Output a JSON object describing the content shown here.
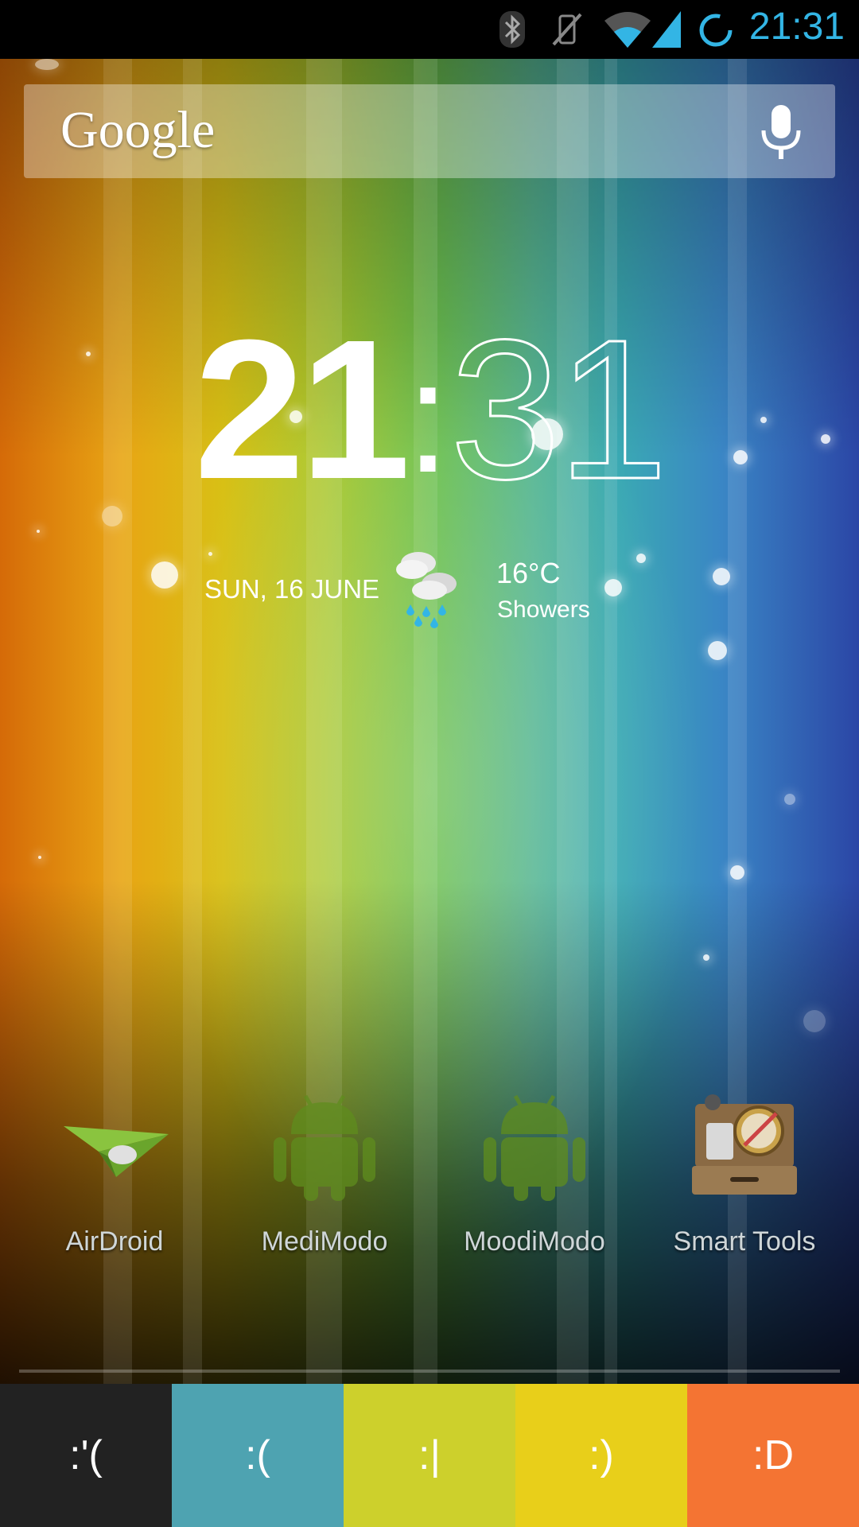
{
  "status_bar": {
    "time": "21:31",
    "icons": [
      "bluetooth-icon",
      "vibrate-off-icon",
      "wifi-icon",
      "cell-signal-icon",
      "sync-icon"
    ],
    "accent_color": "#33b5e5"
  },
  "search": {
    "logo_text": "Google",
    "mic_icon": "mic-icon"
  },
  "clock": {
    "hours": "21",
    "separator": ":",
    "minutes": "31"
  },
  "weather": {
    "date": "SUN, 16 JUNE",
    "icon": "rain-cloud-icon",
    "temperature": "16°C",
    "condition": "Showers"
  },
  "apps": [
    {
      "label": "AirDroid",
      "icon": "paper-plane-icon"
    },
    {
      "label": "MediModo",
      "icon": "android-icon"
    },
    {
      "label": "MoodiModo",
      "icon": "android-icon"
    },
    {
      "label": "Smart Tools",
      "icon": "toolbox-icon"
    }
  ],
  "mood_buttons": [
    {
      "label": ":'(",
      "color": "#222222"
    },
    {
      "label": ":(",
      "color": "#4ea3b1"
    },
    {
      "label": ":|",
      "color": "#cdd02c"
    },
    {
      "label": ":)",
      "color": "#e8cf1a"
    },
    {
      "label": ":D",
      "color": "#f47433"
    }
  ]
}
